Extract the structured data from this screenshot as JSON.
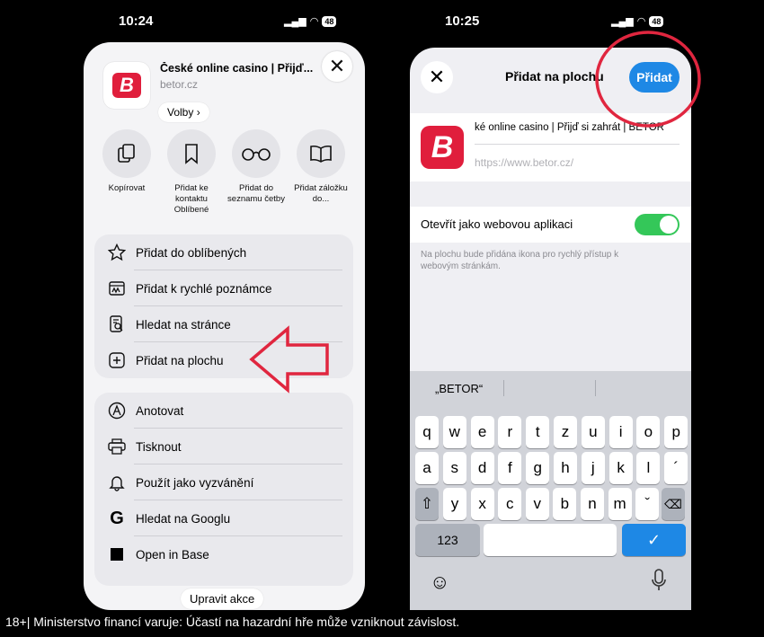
{
  "left": {
    "status": {
      "time": "10:24",
      "battery": "48"
    },
    "header": {
      "title": "České online casino | Přijď...",
      "domain": "betor.cz",
      "options_label": "Volby",
      "logo_letter": "B"
    },
    "actions": [
      {
        "label": "Kopírovat",
        "icon": "copy-icon"
      },
      {
        "label": "Přidat ke kontaktu Oblíbené",
        "icon": "bookmark-icon"
      },
      {
        "label": "Přidat do seznamu četby",
        "icon": "glasses-icon"
      },
      {
        "label": "Přidat záložku do...",
        "icon": "book-icon"
      }
    ],
    "group1": [
      {
        "label": "Přidat do oblíbených",
        "icon": "star-icon"
      },
      {
        "label": "Přidat k rychlé poznámce",
        "icon": "quick-note-icon"
      },
      {
        "label": "Hledat na stránce",
        "icon": "find-in-page-icon"
      },
      {
        "label": "Přidat na plochu",
        "icon": "add-square-icon"
      }
    ],
    "group2": [
      {
        "label": "Anotovat",
        "icon": "markup-icon"
      },
      {
        "label": "Tisknout",
        "icon": "printer-icon"
      },
      {
        "label": "Použít jako vyzvánění",
        "icon": "bell-icon"
      },
      {
        "label": "Hledat na Googlu",
        "icon": "google-icon"
      },
      {
        "label": "Open in Base",
        "icon": "square-icon"
      }
    ],
    "edit_actions_label": "Upravit akce"
  },
  "right": {
    "status": {
      "time": "10:25",
      "battery": "48"
    },
    "nav": {
      "title": "Přidat na plochu",
      "add_label": "Přidat"
    },
    "name_value": "ké online casino | Přijď si zahrát | BETOR",
    "url_placeholder": "https://www.betor.cz/",
    "webapp_toggle_label": "Otevřít jako webovou aplikaci",
    "webapp_toggle_on": true,
    "hint": "Na plochu bude přidána ikona pro rychlý přístup k webovým stránkám.",
    "suggestion": "„BETOR“",
    "keyboard": {
      "row1": [
        "q",
        "w",
        "e",
        "r",
        "t",
        "z",
        "u",
        "i",
        "o",
        "p"
      ],
      "row2": [
        "a",
        "s",
        "d",
        "f",
        "g",
        "h",
        "j",
        "k",
        "l",
        "´"
      ],
      "row3": [
        "y",
        "x",
        "c",
        "v",
        "b",
        "n",
        "m",
        "ˇ"
      ],
      "numbers_label": "123",
      "return_label": "✓"
    }
  },
  "footer_disclaimer": "18+| Ministerstvo financí varuje: Účastí na hazardní hře může vzniknout závislost.",
  "colors": {
    "brand_red": "#e01e3c",
    "accent_blue": "#1e88e5",
    "toggle_green": "#34c759",
    "arrow_red": "#e0263f"
  }
}
